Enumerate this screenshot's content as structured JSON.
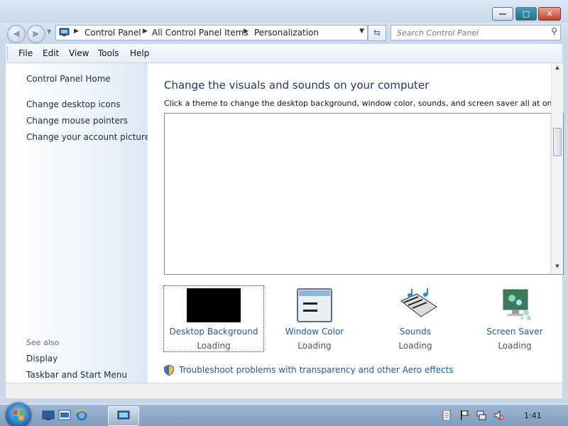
{
  "window": {
    "minimize_glyph": "—",
    "maximize_glyph": "□",
    "close_glyph": "✕"
  },
  "address_bar": {
    "breadcrumbs": [
      "Control Panel",
      "All Control Panel Items",
      "Personalization"
    ],
    "search_placeholder": "Search Control Panel"
  },
  "menu": {
    "items": [
      {
        "label": "File",
        "accel": "F"
      },
      {
        "label": "Edit",
        "accel": "E"
      },
      {
        "label": "View",
        "accel": "V"
      },
      {
        "label": "Tools",
        "accel": "T"
      },
      {
        "label": "Help",
        "accel": "H"
      }
    ]
  },
  "left_pane": {
    "home": "Control Panel Home",
    "links": [
      "Change desktop icons",
      "Change mouse pointers",
      "Change your account picture"
    ],
    "see_also_label": "See also",
    "see_also": [
      "Display",
      "Taskbar and Start Menu"
    ]
  },
  "main": {
    "title": "Change the visuals and sounds on your computer",
    "description": "Click a theme to change the desktop background, window color, sounds, and screen saver all at once.",
    "options": [
      {
        "label": "Desktop Background",
        "status": "Loading"
      },
      {
        "label": "Window Color",
        "status": "Loading"
      },
      {
        "label": "Sounds",
        "status": "Loading"
      },
      {
        "label": "Screen Saver",
        "status": "Loading"
      }
    ],
    "troubleshoot_link": "Troubleshoot problems with transparency and other Aero effects"
  },
  "taskbar": {
    "clock": "1:41"
  },
  "colors": {
    "link": "#1e5aa8",
    "title": "#1e3a63",
    "close_button": "#c5412c",
    "maximize_button": "#1f6f80"
  },
  "icons": [
    "back-arrow-icon",
    "forward-arrow-icon",
    "control-panel-icon",
    "refresh-icon",
    "search-icon",
    "shield-icon",
    "windows-flag-icon",
    "show-desktop-icon",
    "explorer-icon",
    "ie-icon",
    "control-panel-taskbar-icon",
    "notes-icon",
    "action-center-flag-icon",
    "network-icon",
    "volume-muted-icon"
  ]
}
